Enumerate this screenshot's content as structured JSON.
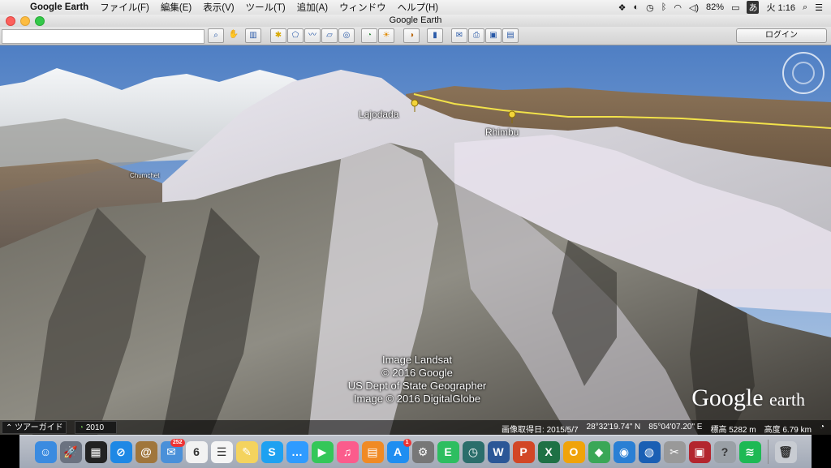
{
  "menubar": {
    "app_name": "Google Earth",
    "items": [
      "ファイル(F)",
      "編集(E)",
      "表示(V)",
      "ツール(T)",
      "追加(A)",
      "ウィンドウ",
      "ヘルプ(H)"
    ],
    "battery": "82%",
    "input_method": "あ",
    "clock": "火 1:16"
  },
  "window": {
    "title": "Google Earth"
  },
  "toolbar": {
    "search_placeholder": "",
    "login_label": "ログイン"
  },
  "map": {
    "places": [
      "Lajodada",
      "Rhimbu",
      "Chumchet"
    ],
    "attribution": [
      "Image Landsat",
      "© 2016 Google",
      "US Dept of State Geographer",
      "Image © 2016 DigitalGlobe"
    ],
    "logo_main": "Google",
    "logo_sub": "earth"
  },
  "status": {
    "tour_label": "ツアーガイド",
    "year": "2010",
    "imagery_date": "画像取得日: 2015/5/7",
    "latitude": "28°32'19.74\" N",
    "longitude": "85°04'07.20\" E",
    "elevation_label": "標高",
    "elevation": "5282 m",
    "altitude_label": "高度",
    "altitude": "6.79 km"
  },
  "dock": {
    "apps": [
      {
        "name": "finder",
        "glyph": "☺",
        "color": "#3b8be0"
      },
      {
        "name": "launchpad",
        "glyph": "🚀",
        "color": "#6b7280"
      },
      {
        "name": "mission-control",
        "glyph": "▦",
        "color": "#222"
      },
      {
        "name": "safari",
        "glyph": "⊘",
        "color": "#1e88e5"
      },
      {
        "name": "contacts",
        "glyph": "@",
        "color": "#a0763c"
      },
      {
        "name": "mail",
        "glyph": "✉",
        "color": "#4a90d9",
        "badge": "252"
      },
      {
        "name": "calendar",
        "glyph": "6",
        "color": "#f2f2f2"
      },
      {
        "name": "reminders",
        "glyph": "☰",
        "color": "#f5f5f5"
      },
      {
        "name": "notes",
        "glyph": "✎",
        "color": "#f4d35e"
      },
      {
        "name": "skype",
        "glyph": "S",
        "color": "#1ea1f1"
      },
      {
        "name": "messages",
        "glyph": "…",
        "color": "#2f9bff"
      },
      {
        "name": "facetime",
        "glyph": "▶",
        "color": "#34c759"
      },
      {
        "name": "itunes",
        "glyph": "♫",
        "color": "#fb5c8c"
      },
      {
        "name": "ibooks",
        "glyph": "▤",
        "color": "#f08a24"
      },
      {
        "name": "app-store",
        "glyph": "A",
        "color": "#1f8ef1",
        "badge": "1"
      },
      {
        "name": "system-preferences",
        "glyph": "⚙",
        "color": "#777"
      },
      {
        "name": "evernote",
        "glyph": "E",
        "color": "#2dbe60"
      },
      {
        "name": "time-machine",
        "glyph": "◷",
        "color": "#2b6e6b"
      },
      {
        "name": "word",
        "glyph": "W",
        "color": "#2b5797"
      },
      {
        "name": "powerpoint",
        "glyph": "P",
        "color": "#d24726"
      },
      {
        "name": "excel",
        "glyph": "X",
        "color": "#1e7145"
      },
      {
        "name": "outlook",
        "glyph": "O",
        "color": "#f0a30a"
      },
      {
        "name": "maps",
        "glyph": "◆",
        "color": "#3aa757"
      },
      {
        "name": "network",
        "glyph": "◉",
        "color": "#2a7fd4"
      },
      {
        "name": "google-earth",
        "glyph": "◍",
        "color": "#1a5fb4"
      },
      {
        "name": "preview",
        "glyph": "✂",
        "color": "#999"
      },
      {
        "name": "photo-booth",
        "glyph": "▣",
        "color": "#b3262e"
      },
      {
        "name": "help",
        "glyph": "?",
        "color": "#9aa0a6"
      },
      {
        "name": "spotify",
        "glyph": "≋",
        "color": "#1db954"
      },
      {
        "name": "trash",
        "glyph": "🗑",
        "color": "#c8ccd2"
      }
    ]
  }
}
